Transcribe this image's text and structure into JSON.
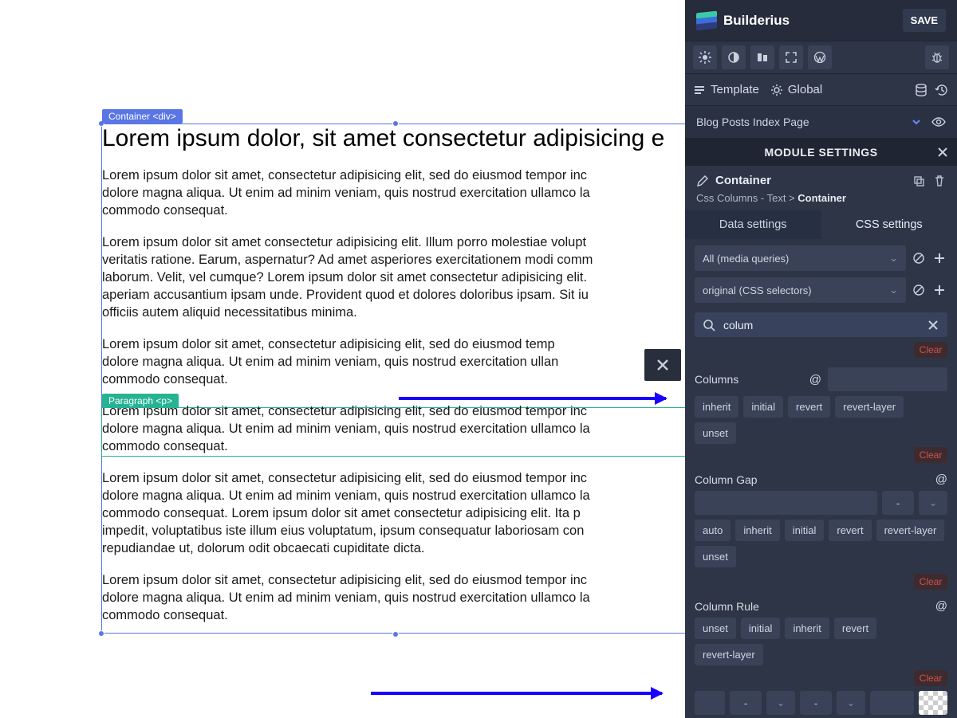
{
  "header": {
    "brand": "Builderius",
    "save": "SAVE"
  },
  "tabs1": {
    "template": "Template",
    "global": "Global"
  },
  "template_row": {
    "name": "Blog Posts Index Page"
  },
  "module_settings": {
    "title": "MODULE SETTINGS",
    "module": "Container",
    "breadcrumb_prefix": "Css Columns - Text > ",
    "breadcrumb_current": "Container"
  },
  "tabs2": {
    "data": "Data settings",
    "css": "CSS settings"
  },
  "selectors": {
    "media": "All (media queries)",
    "css": "original (CSS selectors)"
  },
  "search": {
    "value": "colum"
  },
  "clear": "Clear",
  "props": {
    "columns": {
      "label": "Columns",
      "pills": [
        "inherit",
        "initial",
        "revert",
        "revert-layer",
        "unset"
      ]
    },
    "column_gap": {
      "label": "Column Gap",
      "unit": "-",
      "pills": [
        "auto",
        "inherit",
        "initial",
        "revert",
        "revert-layer",
        "unset"
      ]
    },
    "column_rule": {
      "label": "Column Rule",
      "pills": [
        "unset",
        "initial",
        "inherit",
        "revert",
        "revert-layer"
      ],
      "sel1": "-",
      "sel2": "-"
    }
  },
  "canvas": {
    "container_tag": "Container <div>",
    "paragraph_tag": "Paragraph <p>",
    "heading": "Lorem ipsum dolor, sit amet consectetur adipisicing e",
    "p1": "Lorem ipsum dolor sit amet, consectetur adipisicing elit, sed do eiusmod tempor inc\ndolore magna aliqua. Ut enim ad minim veniam, quis nostrud exercitation ullamco la\ncommodo consequat.",
    "p2": "Lorem ipsum dolor sit amet consectetur adipisicing elit. Illum porro molestiae volupt\nveritatis ratione. Earum, aspernatur? Ad amet asperiores exercitationem modi comm\nlaborum. Velit, vel cumque? Lorem ipsum dolor sit amet consectetur adipisicing elit.\naperiam accusantium ipsam unde. Provident quod et dolores doloribus ipsam. Sit iu\nofficiis autem aliquid necessitatibus minima.",
    "p3": "Lorem ipsum dolor sit amet, consectetur adipisicing elit, sed do eiusmod temp\ndolore magna aliqua. Ut enim ad minim veniam, quis nostrud exercitation ullan\ncommodo consequat.",
    "p4": "Lorem ipsum dolor sit amet, consectetur adipisicing elit, sed do eiusmod tempor inc\ndolore magna aliqua. Ut enim ad minim veniam, quis nostrud exercitation ullamco la\ncommodo consequat.",
    "p5": "Lorem ipsum dolor sit amet, consectetur adipisicing elit, sed do eiusmod tempor inc\ndolore magna aliqua. Ut enim ad minim veniam, quis nostrud exercitation ullamco la\ncommodo consequat. Lorem ipsum dolor sit amet consectetur adipisicing elit. Ita p\nimpedit, voluptatibus iste illum eius voluptatum, ipsum consequatur laboriosam con\nrepudiandae ut, dolorum odit obcaecati cupiditate dicta.",
    "p6": "Lorem ipsum dolor sit amet, consectetur adipisicing elit, sed do eiusmod tempor inc\ndolore magna aliqua. Ut enim ad minim veniam, quis nostrud exercitation ullamco la\ncommodo consequat."
  }
}
